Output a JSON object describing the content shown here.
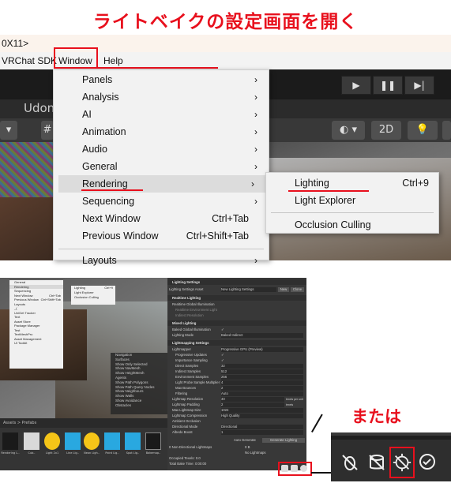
{
  "heading": "ライトベイクの設定画面を開く",
  "window_title": "0X11>",
  "menubar": {
    "items": [
      "VRChat SDK",
      "Window",
      "Help"
    ]
  },
  "tabs": {
    "udon": "Udon"
  },
  "scene_toolbar": {
    "mode_2d": "2D"
  },
  "window_menu": {
    "items": [
      {
        "label": "Panels",
        "submenu": true
      },
      {
        "label": "Analysis",
        "submenu": true
      },
      {
        "label": "AI",
        "submenu": true
      },
      {
        "label": "Animation",
        "submenu": true
      },
      {
        "label": "Audio",
        "submenu": true
      },
      {
        "label": "General",
        "submenu": true
      },
      {
        "label": "Rendering",
        "submenu": true,
        "selected": true
      },
      {
        "label": "Sequencing",
        "submenu": true
      },
      {
        "label": "Next Window",
        "shortcut": "Ctrl+Tab"
      },
      {
        "label": "Previous Window",
        "shortcut": "Ctrl+Shift+Tab"
      },
      {
        "label": "Layouts",
        "submenu": true
      }
    ]
  },
  "rendering_submenu": {
    "items": [
      {
        "label": "Lighting",
        "shortcut": "Ctrl+9"
      },
      {
        "label": "Light Explorer",
        "shortcut": ""
      },
      {
        "label": "Occlusion Culling",
        "shortcut": ""
      }
    ]
  },
  "mini_menu": {
    "items": [
      "General",
      "Rendering",
      "Sequencing",
      "Next Window",
      "Previous Window",
      "Layouts",
      "_(",
      "UniGet Tracker",
      "Text",
      "Asset Store",
      "Package Manager",
      "Test",
      "TextMeshPro",
      "Asset Management",
      "UI Toolkit"
    ],
    "shortcuts": [
      "Ctrl+Tab",
      "Ctrl+Shift+Tab"
    ],
    "submenu": [
      "Lighting",
      "Light Explorer",
      "Occlusion Culling"
    ],
    "submenu_shortcut": "Ctrl+9"
  },
  "scene_overlay": {
    "items": [
      "Navigation",
      "Surfaces",
      "Show Only Selected",
      "Show NavMesh",
      "Show HeightMesh",
      "Agents",
      "Show Path Polygons",
      "Show Path Query Nodes",
      "Show Neighbours",
      "Show Walls",
      "Show Avoidance",
      "Obstacles"
    ]
  },
  "project_bar": {
    "label": "Assets > Prefabs"
  },
  "asset_items": [
    "Rendering L..",
    "Cub..",
    "Light 2x1",
    "Line Lig..",
    "Neon Ligh..",
    "Point Lig..",
    "Spot Lig..",
    "Bakemap.."
  ],
  "lighting_panel": {
    "title": "Lighting Settings",
    "settings_asset_label": "Lighting Settings Asset",
    "settings_asset_value": "New Lighting Settings",
    "new_btn": "New",
    "clone_btn": "Clone",
    "sections": {
      "realtime": "Realtime Lighting",
      "mixed": "Mixed Lighting",
      "lightmapping": "Lightmapping Settings"
    },
    "rows": [
      {
        "label": "Realtime Global Illumination",
        "value": ""
      },
      {
        "label": "Realtime Environment Light",
        "value": ""
      },
      {
        "label": "Indirect Resolution",
        "value": ""
      },
      {
        "label": "Baked Global Illumination",
        "value": "✓"
      },
      {
        "label": "Lighting Mode",
        "value": "Baked Indirect"
      },
      {
        "label": "Lightmapper",
        "value": "Progressive GPU (Preview)"
      },
      {
        "label": "Progressive Updates",
        "value": "✓"
      },
      {
        "label": "Importance Sampling",
        "value": "✓"
      },
      {
        "label": "Direct Samples",
        "value": "32"
      },
      {
        "label": "Indirect Samples",
        "value": "512"
      },
      {
        "label": "Environment Samples",
        "value": "256"
      },
      {
        "label": "Light Probe Sample Multiplier",
        "value": "4"
      },
      {
        "label": "Max Bounces",
        "value": "2"
      },
      {
        "label": "Filtering",
        "value": "Auto"
      },
      {
        "label": "Lightmap Resolution",
        "value": "40"
      },
      {
        "label": "Lightmap Padding",
        "value": "2"
      },
      {
        "label": "Max Lightmap Size",
        "value": "1024"
      },
      {
        "label": "Lightmap Compression",
        "value": "High Quality"
      },
      {
        "label": "Ambient Occlusion",
        "value": ""
      },
      {
        "label": "Directional Mode",
        "value": "Directional"
      },
      {
        "label": "Albedo Boost",
        "value": "1"
      }
    ],
    "units": [
      "texels per unit",
      "texels"
    ],
    "auto_generate": "Auto Generate",
    "generate_btn": "Generate Lighting",
    "stats": [
      "0 Non-Directional Lightmaps",
      "0 B",
      "No Lightmaps",
      "Occupied Texels: 0.0",
      "Total Bake Time: 0:00:00"
    ]
  },
  "alt_label": "または",
  "colors": {
    "accent": "#e8101d",
    "editor_dark": "#383838",
    "menu_bg": "#f2f2f2"
  }
}
